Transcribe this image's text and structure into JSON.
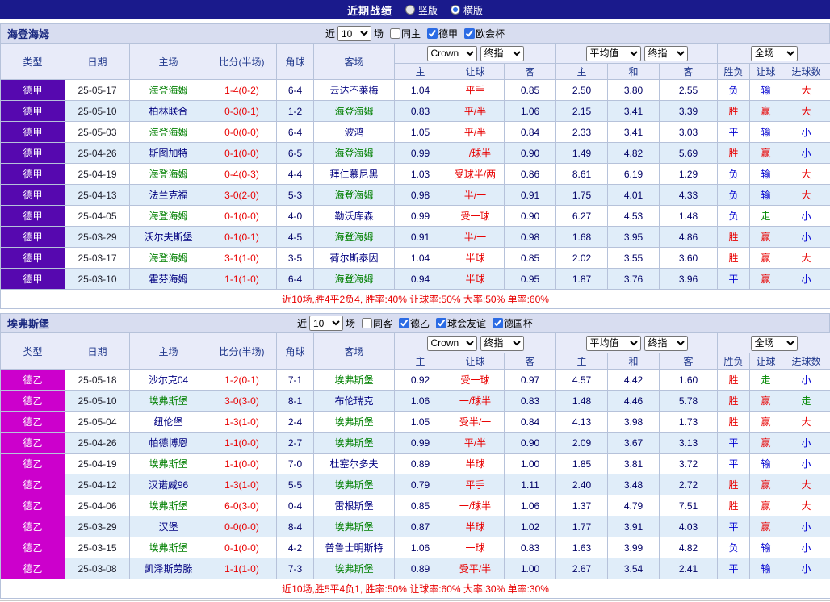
{
  "topbar": {
    "title": "近期战绩",
    "radios": [
      {
        "label": "竖版",
        "selected": false
      },
      {
        "label": "横版",
        "selected": true
      }
    ]
  },
  "table_header": {
    "static_cols": [
      "类型",
      "日期",
      "主场",
      "比分(半场)",
      "角球",
      "客场"
    ],
    "group1": {
      "select1": "Crown",
      "select2": "终指",
      "subcols": [
        "主",
        "让球",
        "客"
      ]
    },
    "group2": {
      "select1": "平均值",
      "select2": "终指",
      "subcols": [
        "主",
        "和",
        "客"
      ]
    },
    "group3": {
      "select": "全场",
      "subcols": [
        "胜负",
        "让球",
        "进球数"
      ]
    }
  },
  "sections": [
    {
      "team": "海登海姆",
      "league_color": "#5608af",
      "filter": {
        "prefix": "近",
        "count": "10",
        "suffix": "场",
        "checkboxes": [
          {
            "label": "同主",
            "checked": false
          },
          {
            "label": "德甲",
            "checked": true
          },
          {
            "label": "欧会杯",
            "checked": true
          }
        ]
      },
      "rows": [
        {
          "league": "德甲",
          "date": "25-05-17",
          "home": "海登海姆",
          "home_focus": true,
          "score": "1-4(0-2)",
          "corners": "6-4",
          "away": "云达不莱梅",
          "away_focus": false,
          "asia": [
            "1.04",
            "平手",
            "0.85"
          ],
          "euro": [
            "2.50",
            "3.80",
            "2.55"
          ],
          "results": [
            "负",
            "输",
            "大"
          ]
        },
        {
          "league": "德甲",
          "date": "25-05-10",
          "home": "柏林联合",
          "home_focus": false,
          "score": "0-3(0-1)",
          "corners": "1-2",
          "away": "海登海姆",
          "away_focus": true,
          "asia": [
            "0.83",
            "平/半",
            "1.06"
          ],
          "euro": [
            "2.15",
            "3.41",
            "3.39"
          ],
          "results": [
            "胜",
            "赢",
            "大"
          ]
        },
        {
          "league": "德甲",
          "date": "25-05-03",
          "home": "海登海姆",
          "home_focus": true,
          "score": "0-0(0-0)",
          "corners": "6-4",
          "away": "波鸿",
          "away_focus": false,
          "asia": [
            "1.05",
            "平/半",
            "0.84"
          ],
          "euro": [
            "2.33",
            "3.41",
            "3.03"
          ],
          "results": [
            "平",
            "输",
            "小"
          ]
        },
        {
          "league": "德甲",
          "date": "25-04-26",
          "home": "斯图加特",
          "home_focus": false,
          "score": "0-1(0-0)",
          "corners": "6-5",
          "away": "海登海姆",
          "away_focus": true,
          "asia": [
            "0.99",
            "一/球半",
            "0.90"
          ],
          "euro": [
            "1.49",
            "4.82",
            "5.69"
          ],
          "results": [
            "胜",
            "赢",
            "小"
          ]
        },
        {
          "league": "德甲",
          "date": "25-04-19",
          "home": "海登海姆",
          "home_focus": true,
          "score": "0-4(0-3)",
          "corners": "4-4",
          "away": "拜仁慕尼黑",
          "away_focus": false,
          "asia": [
            "1.03",
            "受球半/两",
            "0.86"
          ],
          "euro": [
            "8.61",
            "6.19",
            "1.29"
          ],
          "results": [
            "负",
            "输",
            "大"
          ]
        },
        {
          "league": "德甲",
          "date": "25-04-13",
          "home": "法兰克福",
          "home_focus": false,
          "score": "3-0(2-0)",
          "corners": "5-3",
          "away": "海登海姆",
          "away_focus": true,
          "asia": [
            "0.98",
            "半/一",
            "0.91"
          ],
          "euro": [
            "1.75",
            "4.01",
            "4.33"
          ],
          "results": [
            "负",
            "输",
            "大"
          ]
        },
        {
          "league": "德甲",
          "date": "25-04-05",
          "home": "海登海姆",
          "home_focus": true,
          "score": "0-1(0-0)",
          "corners": "4-0",
          "away": "勒沃库森",
          "away_focus": false,
          "asia": [
            "0.99",
            "受一球",
            "0.90"
          ],
          "euro": [
            "6.27",
            "4.53",
            "1.48"
          ],
          "results": [
            "负",
            "走",
            "小"
          ]
        },
        {
          "league": "德甲",
          "date": "25-03-29",
          "home": "沃尔夫斯堡",
          "home_focus": false,
          "score": "0-1(0-1)",
          "corners": "4-5",
          "away": "海登海姆",
          "away_focus": true,
          "asia": [
            "0.91",
            "半/一",
            "0.98"
          ],
          "euro": [
            "1.68",
            "3.95",
            "4.86"
          ],
          "results": [
            "胜",
            "赢",
            "小"
          ]
        },
        {
          "league": "德甲",
          "date": "25-03-17",
          "home": "海登海姆",
          "home_focus": true,
          "score": "3-1(1-0)",
          "corners": "3-5",
          "away": "荷尔斯泰因",
          "away_focus": false,
          "asia": [
            "1.04",
            "半球",
            "0.85"
          ],
          "euro": [
            "2.02",
            "3.55",
            "3.60"
          ],
          "results": [
            "胜",
            "赢",
            "大"
          ]
        },
        {
          "league": "德甲",
          "date": "25-03-10",
          "home": "霍芬海姆",
          "home_focus": false,
          "score": "1-1(1-0)",
          "corners": "6-4",
          "away": "海登海姆",
          "away_focus": true,
          "asia": [
            "0.94",
            "半球",
            "0.95"
          ],
          "euro": [
            "1.87",
            "3.76",
            "3.96"
          ],
          "results": [
            "平",
            "赢",
            "小"
          ]
        }
      ],
      "summary": "近10场,胜4平2负4, 胜率:40% 让球率:50% 大率:50% 单率:60%"
    },
    {
      "team": "埃弗斯堡",
      "league_color": "#cc00cc",
      "filter": {
        "prefix": "近",
        "count": "10",
        "suffix": "场",
        "checkboxes": [
          {
            "label": "同客",
            "checked": false
          },
          {
            "label": "德乙",
            "checked": true
          },
          {
            "label": "球会友谊",
            "checked": true
          },
          {
            "label": "德国杯",
            "checked": true
          }
        ]
      },
      "rows": [
        {
          "league": "德乙",
          "date": "25-05-18",
          "home": "沙尔克04",
          "home_focus": false,
          "score": "1-2(0-1)",
          "corners": "7-1",
          "away": "埃弗斯堡",
          "away_focus": true,
          "asia": [
            "0.92",
            "受一球",
            "0.97"
          ],
          "euro": [
            "4.57",
            "4.42",
            "1.60"
          ],
          "results": [
            "胜",
            "走",
            "小"
          ]
        },
        {
          "league": "德乙",
          "date": "25-05-10",
          "home": "埃弗斯堡",
          "home_focus": true,
          "score": "3-0(3-0)",
          "corners": "8-1",
          "away": "布伦瑞克",
          "away_focus": false,
          "asia": [
            "1.06",
            "一/球半",
            "0.83"
          ],
          "euro": [
            "1.48",
            "4.46",
            "5.78"
          ],
          "results": [
            "胜",
            "赢",
            "走"
          ]
        },
        {
          "league": "德乙",
          "date": "25-05-04",
          "home": "纽伦堡",
          "home_focus": false,
          "score": "1-3(1-0)",
          "corners": "2-4",
          "away": "埃弗斯堡",
          "away_focus": true,
          "asia": [
            "1.05",
            "受半/一",
            "0.84"
          ],
          "euro": [
            "4.13",
            "3.98",
            "1.73"
          ],
          "results": [
            "胜",
            "赢",
            "大"
          ]
        },
        {
          "league": "德乙",
          "date": "25-04-26",
          "home": "帕德博恩",
          "home_focus": false,
          "score": "1-1(0-0)",
          "corners": "2-7",
          "away": "埃弗斯堡",
          "away_focus": true,
          "asia": [
            "0.99",
            "平/半",
            "0.90"
          ],
          "euro": [
            "2.09",
            "3.67",
            "3.13"
          ],
          "results": [
            "平",
            "赢",
            "小"
          ]
        },
        {
          "league": "德乙",
          "date": "25-04-19",
          "home": "埃弗斯堡",
          "home_focus": true,
          "score": "1-1(0-0)",
          "corners": "7-0",
          "away": "杜塞尔多夫",
          "away_focus": false,
          "asia": [
            "0.89",
            "半球",
            "1.00"
          ],
          "euro": [
            "1.85",
            "3.81",
            "3.72"
          ],
          "results": [
            "平",
            "输",
            "小"
          ]
        },
        {
          "league": "德乙",
          "date": "25-04-12",
          "home": "汉诺威96",
          "home_focus": false,
          "score": "1-3(1-0)",
          "corners": "5-5",
          "away": "埃弗斯堡",
          "away_focus": true,
          "asia": [
            "0.79",
            "平手",
            "1.11"
          ],
          "euro": [
            "2.40",
            "3.48",
            "2.72"
          ],
          "results": [
            "胜",
            "赢",
            "大"
          ]
        },
        {
          "league": "德乙",
          "date": "25-04-06",
          "home": "埃弗斯堡",
          "home_focus": true,
          "score": "6-0(3-0)",
          "corners": "0-4",
          "away": "雷根斯堡",
          "away_focus": false,
          "asia": [
            "0.85",
            "一/球半",
            "1.06"
          ],
          "euro": [
            "1.37",
            "4.79",
            "7.51"
          ],
          "results": [
            "胜",
            "赢",
            "大"
          ]
        },
        {
          "league": "德乙",
          "date": "25-03-29",
          "home": "汉堡",
          "home_focus": false,
          "score": "0-0(0-0)",
          "corners": "8-4",
          "away": "埃弗斯堡",
          "away_focus": true,
          "asia": [
            "0.87",
            "半球",
            "1.02"
          ],
          "euro": [
            "1.77",
            "3.91",
            "4.03"
          ],
          "results": [
            "平",
            "赢",
            "小"
          ]
        },
        {
          "league": "德乙",
          "date": "25-03-15",
          "home": "埃弗斯堡",
          "home_focus": true,
          "score": "0-1(0-0)",
          "corners": "4-2",
          "away": "普鲁士明斯特",
          "away_focus": false,
          "asia": [
            "1.06",
            "一球",
            "0.83"
          ],
          "euro": [
            "1.63",
            "3.99",
            "4.82"
          ],
          "results": [
            "负",
            "输",
            "小"
          ]
        },
        {
          "league": "德乙",
          "date": "25-03-08",
          "home": "凯泽斯劳滕",
          "home_focus": false,
          "score": "1-1(1-0)",
          "corners": "7-3",
          "away": "埃弗斯堡",
          "away_focus": true,
          "asia": [
            "0.89",
            "受平/半",
            "1.00"
          ],
          "euro": [
            "2.67",
            "3.54",
            "2.41"
          ],
          "results": [
            "平",
            "输",
            "小"
          ]
        }
      ],
      "summary": "近10场,胜5平4负1, 胜率:50% 让球率:60% 大率:30% 单率:30%"
    }
  ]
}
